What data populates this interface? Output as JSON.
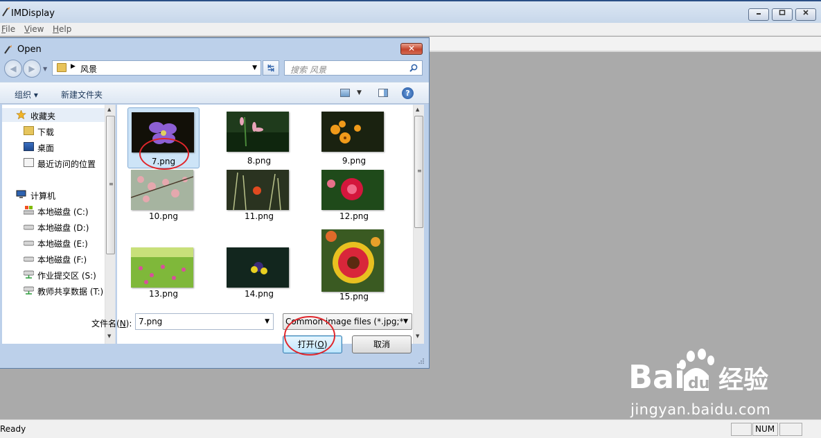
{
  "app": {
    "title": "IMDisplay",
    "menu": [
      {
        "label": "File",
        "accel": "F",
        "rest": "ile"
      },
      {
        "label": "View",
        "accel": "V",
        "rest": "iew"
      },
      {
        "label": "Help",
        "accel": "H",
        "rest": "elp"
      }
    ],
    "status": {
      "ready": "Ready",
      "num": "NUM"
    }
  },
  "dialog": {
    "title": "Open",
    "close_glyph": "✕",
    "address": {
      "folder": "风景"
    },
    "search": {
      "placeholder": "搜索 风景"
    },
    "commandbar": {
      "organize": "组织 ▾",
      "new_folder": "新建文件夹",
      "help": "?"
    },
    "nav": {
      "favorites_label": "收藏夹",
      "favorites": [
        "下载",
        "桌面",
        "最近访问的位置"
      ],
      "computer_label": "计算机",
      "drives": [
        "本地磁盘 (C:)",
        "本地磁盘 (D:)",
        "本地磁盘 (E:)",
        "本地磁盘 (F:)",
        "作业提交区 (S:)",
        "教师共享数据 (T:)"
      ]
    },
    "files": [
      {
        "name": "7.png",
        "selected": true
      },
      {
        "name": "8.png"
      },
      {
        "name": "9.png"
      },
      {
        "name": "10.png"
      },
      {
        "name": "11.png"
      },
      {
        "name": "12.png"
      },
      {
        "name": "13.png"
      },
      {
        "name": "14.png"
      },
      {
        "name": "15.png"
      }
    ],
    "filename": {
      "label_prefix": "文件名(",
      "label_accel": "N",
      "label_suffix": "):",
      "value": "7.png"
    },
    "filetype": {
      "value": "Common image files (*.jpg;*"
    },
    "open_button": {
      "prefix": "打开(",
      "accel": "O",
      "suffix": ")"
    },
    "cancel_button": {
      "label": "取消"
    }
  },
  "watermark": {
    "site": "jingyan.baidu.com"
  },
  "colors": {
    "annotation_red": "#e0262b",
    "dialog_frame": "#bcd0ea",
    "client_gray": "#aaaaaa"
  }
}
